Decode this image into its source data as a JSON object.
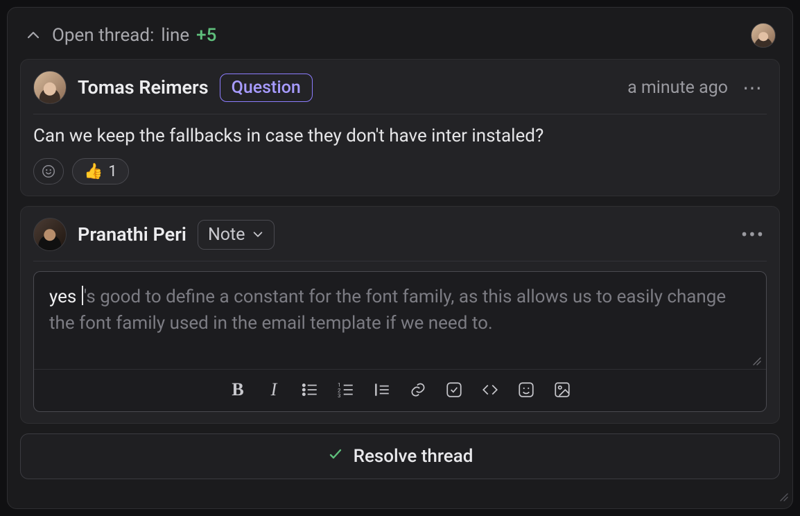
{
  "header": {
    "prefix": "Open thread:",
    "line_word": "line",
    "line_num": "+5"
  },
  "comment": {
    "author": "Tomas Reimers",
    "tag": "Question",
    "time": "a minute ago",
    "body": "Can we keep the fallbacks in case they don't have inter instaled?",
    "reaction_emoji": "👍",
    "reaction_count": "1"
  },
  "compose": {
    "author": "Pranathi Peri",
    "type_label": "Note",
    "typed": "yes ",
    "placeholder_rest": "'s good to define a constant for the font family, as this allows us to easily change the font family used in the email template if we need to."
  },
  "toolbar": {
    "bold": "B",
    "italic": "I"
  },
  "resolve": {
    "label": "Resolve thread"
  }
}
